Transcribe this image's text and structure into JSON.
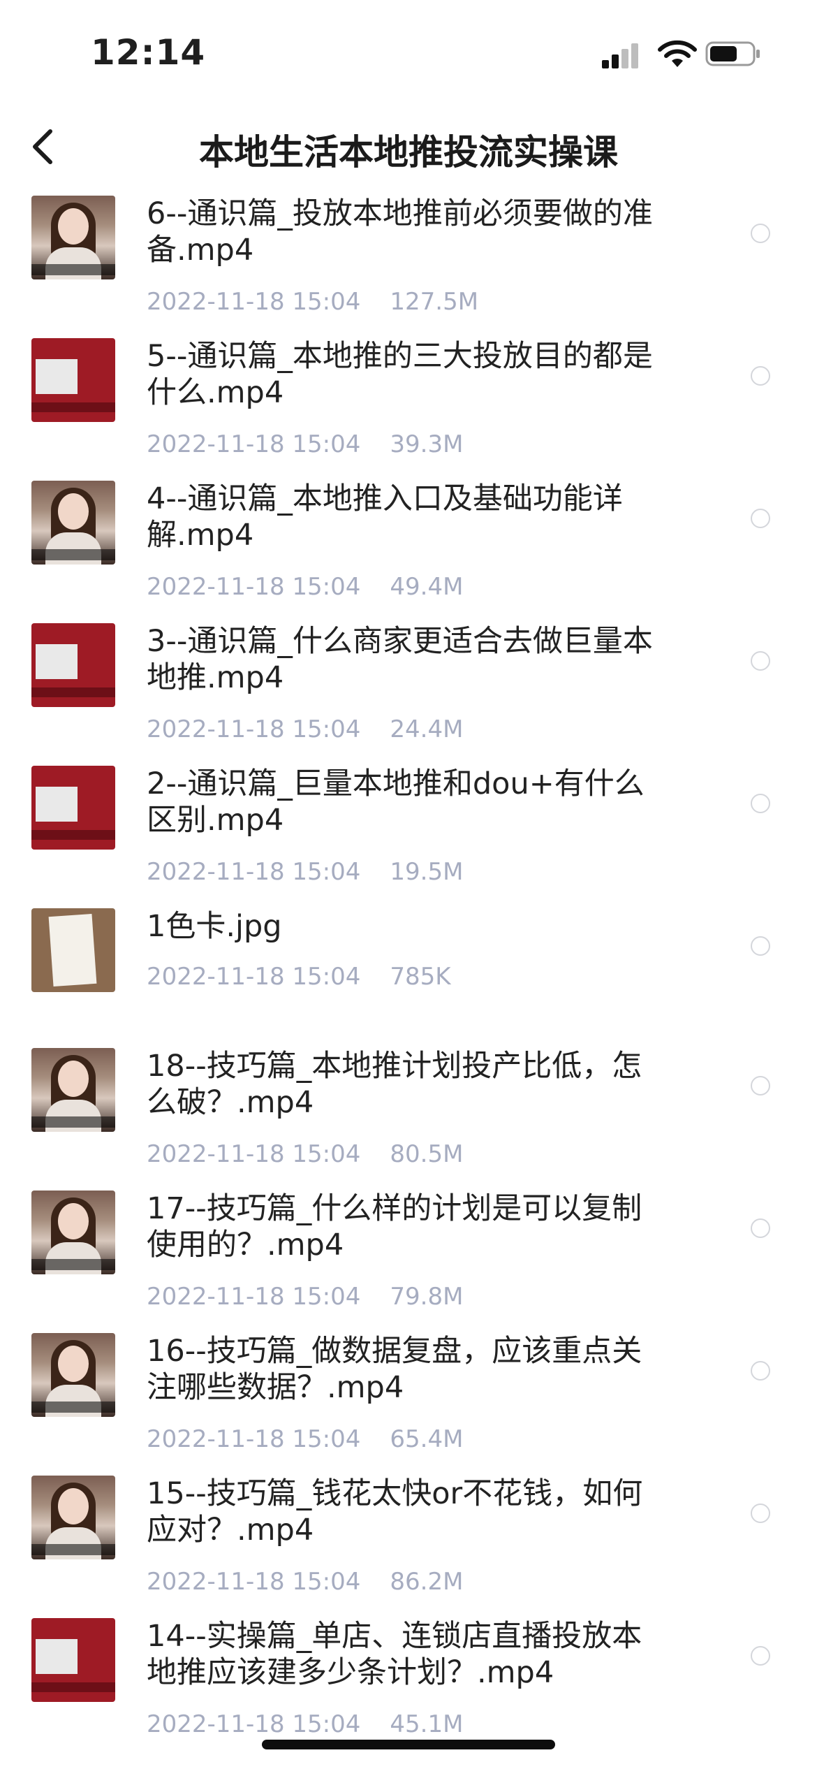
{
  "status": {
    "time": "12:14"
  },
  "nav": {
    "title": "本地生活本地推投流实操课"
  },
  "files": [
    {
      "name": "6--通识篇_投放本地推前必须要做的准备.mp4",
      "date": "2022-11-18 15:04",
      "size": "127.5M",
      "thumb": "person"
    },
    {
      "name": "5--通识篇_本地推的三大投放目的都是什么.mp4",
      "date": "2022-11-18 15:04",
      "size": "39.3M",
      "thumb": "red"
    },
    {
      "name": "4--通识篇_本地推入口及基础功能详解.mp4",
      "date": "2022-11-18 15:04",
      "size": "49.4M",
      "thumb": "person"
    },
    {
      "name": "3--通识篇_什么商家更适合去做巨量本地推.mp4",
      "date": "2022-11-18 15:04",
      "size": "24.4M",
      "thumb": "red"
    },
    {
      "name": "2--通识篇_巨量本地推和dou+有什么区别.mp4",
      "date": "2022-11-18 15:04",
      "size": "19.5M",
      "thumb": "red"
    },
    {
      "name": "1色卡.jpg",
      "date": "2022-11-18 15:04",
      "size": "785K",
      "thumb": "card"
    },
    {
      "name": "18--技巧篇_本地推计划投产比低，怎么破？.mp4",
      "date": "2022-11-18 15:04",
      "size": "80.5M",
      "thumb": "person"
    },
    {
      "name": "17--技巧篇_什么样的计划是可以复制使用的？.mp4",
      "date": "2022-11-18 15:04",
      "size": "79.8M",
      "thumb": "person"
    },
    {
      "name": "16--技巧篇_做数据复盘，应该重点关注哪些数据？.mp4",
      "date": "2022-11-18 15:04",
      "size": "65.4M",
      "thumb": "person"
    },
    {
      "name": "15--技巧篇_钱花太快or不花钱，如何应对？.mp4",
      "date": "2022-11-18 15:04",
      "size": "86.2M",
      "thumb": "person"
    },
    {
      "name": "14--实操篇_单店、连锁店直播投放本地推应该建多少条计划？.mp4",
      "date": "2022-11-18 15:04",
      "size": "45.1M",
      "thumb": "red"
    }
  ]
}
